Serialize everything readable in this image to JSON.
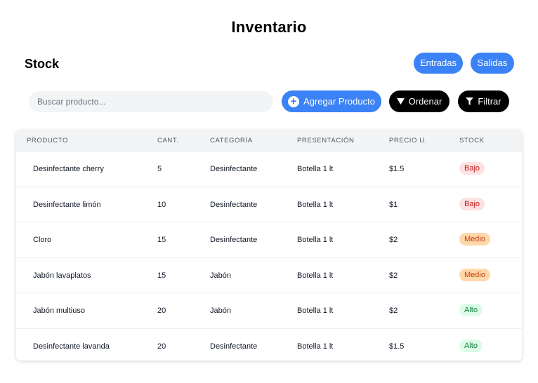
{
  "header": {
    "title": "Inventario",
    "section_title": "Stock",
    "entradas_label": "Entradas",
    "salidas_label": "Salidas"
  },
  "toolbar": {
    "search_placeholder": "Buscar producto...",
    "add_label": "Agregar Producto",
    "add_icon": "plus-circle-icon",
    "sort_label": "Ordenar",
    "sort_icon": "triangle-down-icon",
    "filter_label": "Filtrar",
    "filter_icon": "funnel-icon"
  },
  "colors": {
    "accent": "#3b82f6",
    "dark": "#000000",
    "bajo_bg": "#fee2e2",
    "bajo_text": "#b91c1c",
    "medio_bg": "#fed7aa",
    "medio_text": "#c2410c",
    "alto_bg": "#dcfce7",
    "alto_text": "#15803d"
  },
  "table": {
    "columns": [
      "PRODUCTO",
      "CANT.",
      "CATEGORÍA",
      "PRESENTACIÓN",
      "PRECIO U.",
      "STOCK"
    ],
    "rows": [
      {
        "producto": "Desinfectante cherry",
        "cantidad": "5",
        "categoria": "Desinfectante",
        "presentacion": "Botella 1 lt",
        "precio": "$1.5",
        "stock": "Bajo",
        "stock_level": "bajo"
      },
      {
        "producto": "Desinfectante limón",
        "cantidad": "10",
        "categoria": "Desinfectante",
        "presentacion": "Botella 1 lt",
        "precio": "$1",
        "stock": "Bajo",
        "stock_level": "bajo"
      },
      {
        "producto": "Cloro",
        "cantidad": "15",
        "categoria": "Desinfectante",
        "presentacion": "Botella 1 lt",
        "precio": "$2",
        "stock": "Medio",
        "stock_level": "medio"
      },
      {
        "producto": "Jabón lavaplatos",
        "cantidad": "15",
        "categoria": "Jabón",
        "presentacion": "Botella 1 lt",
        "precio": "$2",
        "stock": "Medio",
        "stock_level": "medio"
      },
      {
        "producto": "Jabón multiuso",
        "cantidad": "20",
        "categoria": "Jabón",
        "presentacion": "Botella 1 lt",
        "precio": "$2",
        "stock": "Alto",
        "stock_level": "alto"
      },
      {
        "producto": "Desinfectante lavanda",
        "cantidad": "20",
        "categoria": "Desinfectante",
        "presentacion": "Botella 1 lt",
        "precio": "$1.5",
        "stock": "Alto",
        "stock_level": "alto"
      }
    ]
  }
}
